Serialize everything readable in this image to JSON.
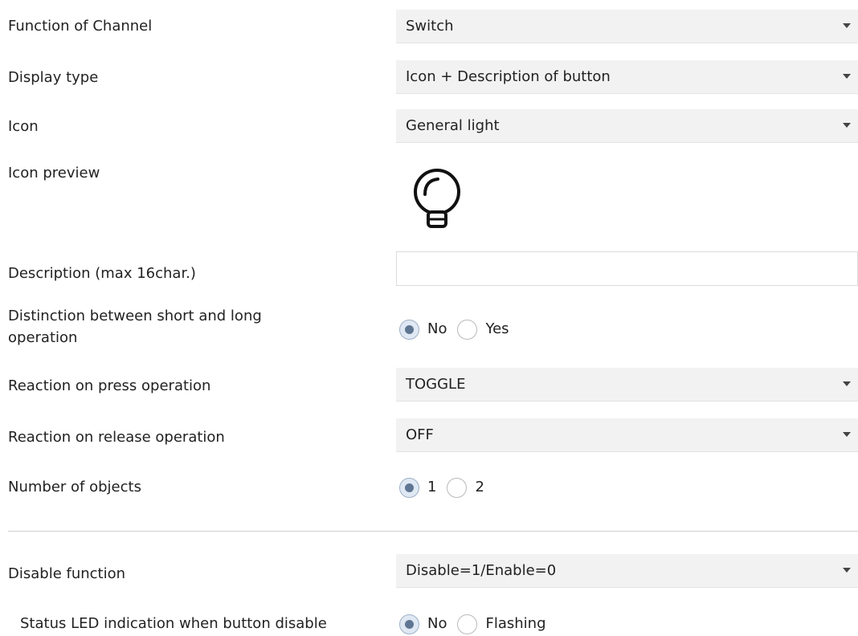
{
  "function_of_channel": {
    "label": "Function of Channel",
    "value": "Switch"
  },
  "display_type": {
    "label": "Display type",
    "value": "Icon + Description of button"
  },
  "icon": {
    "label": "Icon",
    "value": "General light"
  },
  "icon_preview": {
    "label": "Icon preview",
    "icon": "light-bulb-icon"
  },
  "description": {
    "label": "Description (max 16char.)",
    "value": ""
  },
  "distinction": {
    "label_line1": "Distinction between short and long",
    "label_line2": "operation",
    "options": [
      "No",
      "Yes"
    ],
    "selected": "No"
  },
  "reaction_press": {
    "label": "Reaction on press operation",
    "value": "TOGGLE"
  },
  "reaction_release": {
    "label": "Reaction on release operation",
    "value": "OFF"
  },
  "number_of_objects": {
    "label": "Number of objects",
    "options": [
      "1",
      "2"
    ],
    "selected": "1"
  },
  "disable_function": {
    "label": "Disable function",
    "value": "Disable=1/Enable=0"
  },
  "status_led": {
    "label": "Status LED indication when button disable",
    "options": [
      "No",
      "Flashing"
    ],
    "selected": "No"
  },
  "colors": {
    "dropdown_bg": "#f2f2f2",
    "radio_selected": "#5f7692",
    "text": "#222222"
  }
}
